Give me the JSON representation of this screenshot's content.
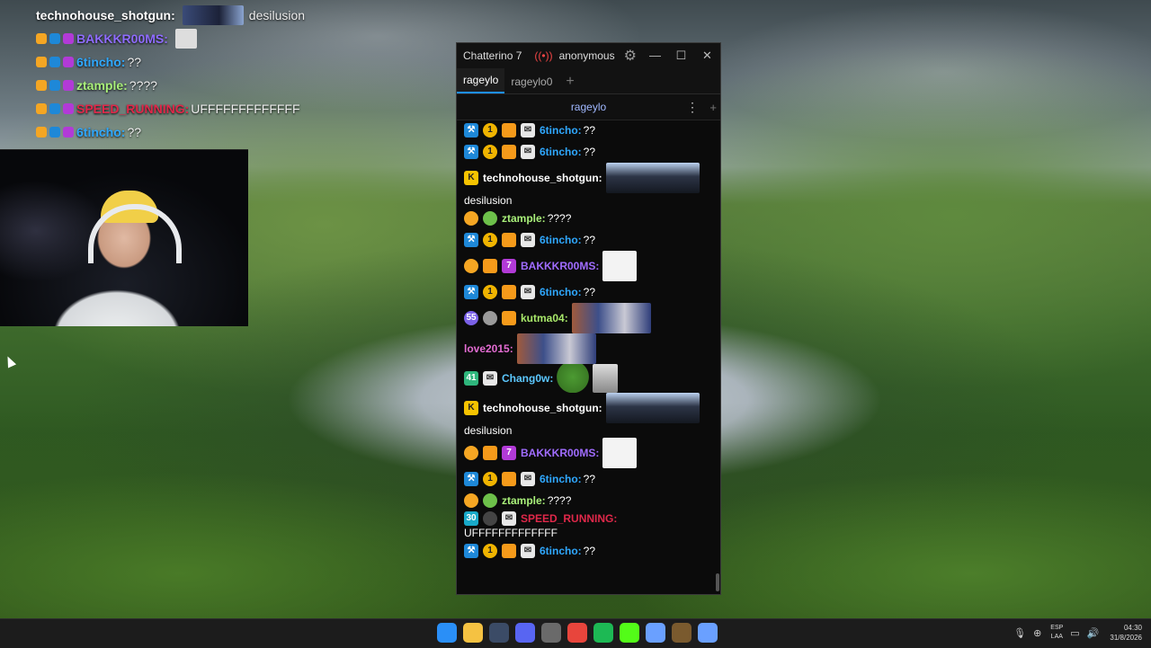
{
  "overlay_chat": [
    {
      "user": "technohouse_shotgun",
      "user_color": "#ffffff",
      "text": "desilusion",
      "emote": "face"
    },
    {
      "user": "BAKKKR00MS",
      "user_color": "#8f6cff",
      "text": "",
      "emote": "meme"
    },
    {
      "user": "6tincho",
      "user_color": "#2fa8ff",
      "text": "??",
      "emote": ""
    },
    {
      "user": "ztample",
      "user_color": "#a9f07a",
      "text": "????",
      "emote": ""
    },
    {
      "user": "SPEED_RUNNING",
      "user_color": "#e0284a",
      "text": "UFFFFFFFFFFFFF",
      "emote": ""
    },
    {
      "user": "6tincho",
      "user_color": "#2fa8ff",
      "text": "??",
      "emote": ""
    }
  ],
  "window": {
    "title": "Chatterino 7",
    "account": "anonymous",
    "minimize": "—",
    "maximize": "☐",
    "close": "✕"
  },
  "tabs": [
    {
      "label": "rageylo",
      "active": true
    },
    {
      "label": "rageylo0",
      "active": false
    }
  ],
  "channel": {
    "name": "rageylo",
    "menu": "⋮",
    "add": "+"
  },
  "messages": [
    {
      "badges": [
        "mod",
        "gold",
        "box",
        "mail"
      ],
      "user": "6tincho",
      "color": "#2fa8ff",
      "text": "??",
      "emote": ""
    },
    {
      "badges": [
        "mod",
        "gold",
        "box",
        "mail"
      ],
      "user": "6tincho",
      "color": "#2fa8ff",
      "text": "??",
      "emote": ""
    },
    {
      "badges": [
        "k"
      ],
      "user": "technohouse_shotgun",
      "color": "#ffffff",
      "text": "desilusion",
      "emote": "face",
      "wrap": true
    },
    {
      "badges": [
        "sun",
        "alien"
      ],
      "user": "ztample",
      "color": "#a9f07a",
      "text": "????",
      "emote": ""
    },
    {
      "badges": [
        "mod",
        "gold",
        "box",
        "mail"
      ],
      "user": "6tincho",
      "color": "#2fa8ff",
      "text": "??",
      "emote": ""
    },
    {
      "badges": [
        "sun",
        "box",
        "7tv"
      ],
      "user": "BAKKKR00MS",
      "color": "#a06cff",
      "text": "",
      "emote": "meme"
    },
    {
      "badges": [
        "mod",
        "gold",
        "box",
        "mail"
      ],
      "user": "6tincho",
      "color": "#2fa8ff",
      "text": "??",
      "emote": ""
    },
    {
      "badges": [
        "55",
        "gray",
        "box"
      ],
      "user": "kutma04",
      "color": "#a8e86a",
      "text": "",
      "emote": "crowd"
    },
    {
      "badges": [],
      "user": "love2015",
      "color": "#e36cd2",
      "text": "",
      "emote": "crowd"
    },
    {
      "badges": [
        "41",
        "mail"
      ],
      "user": "Chang0w",
      "color": "#5cc8ff",
      "text": "",
      "emote": "pepe"
    },
    {
      "badges": [
        "k"
      ],
      "user": "technohouse_shotgun",
      "color": "#ffffff",
      "text": "desilusion",
      "emote": "face",
      "wrap": true
    },
    {
      "badges": [
        "sun",
        "box",
        "7tv"
      ],
      "user": "BAKKKR00MS",
      "color": "#a06cff",
      "text": "",
      "emote": "meme"
    },
    {
      "badges": [
        "mod",
        "gold",
        "box",
        "mail"
      ],
      "user": "6tincho",
      "color": "#2fa8ff",
      "text": "??",
      "emote": ""
    },
    {
      "badges": [
        "sun",
        "alien"
      ],
      "user": "ztample",
      "color": "#a9f07a",
      "text": "????",
      "emote": ""
    },
    {
      "badges": [
        "30",
        "dark",
        "mail"
      ],
      "user": "SPEED_RUNNING",
      "color": "#e0284a",
      "text": "UFFFFFFFFFFFFF",
      "emote": "",
      "wrap": true
    },
    {
      "badges": [
        "mod",
        "gold",
        "box",
        "mail"
      ],
      "user": "6tincho",
      "color": "#2fa8ff",
      "text": "??",
      "emote": ""
    }
  ],
  "taskbar": {
    "apps": [
      {
        "name": "windows-start-icon",
        "color": "#2a8ff7"
      },
      {
        "name": "file-explorer-icon",
        "color": "#f5c242"
      },
      {
        "name": "steam-icon",
        "color": "#3b4b66"
      },
      {
        "name": "discord-icon",
        "color": "#5865f2"
      },
      {
        "name": "obs-icon",
        "color": "#6a6a6a"
      },
      {
        "name": "chrome-icon",
        "color": "#e8453c"
      },
      {
        "name": "spotify-icon",
        "color": "#1db954"
      },
      {
        "name": "kick-icon",
        "color": "#53fc18"
      },
      {
        "name": "chatterino-icon",
        "color": "#6aa0ff"
      },
      {
        "name": "minecraft-icon",
        "color": "#7a5a2e"
      },
      {
        "name": "chatterino-active-icon",
        "color": "#6aa0ff"
      }
    ],
    "language": "ESP",
    "layout": "LAA",
    "time": "04:30",
    "date": "31/8/2026"
  }
}
